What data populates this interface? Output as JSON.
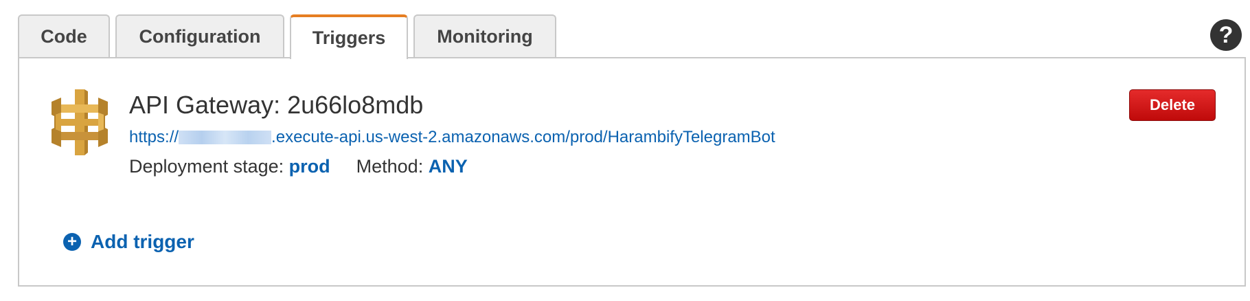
{
  "tabs": [
    {
      "label": "Code",
      "active": false
    },
    {
      "label": "Configuration",
      "active": false
    },
    {
      "label": "Triggers",
      "active": true
    },
    {
      "label": "Monitoring",
      "active": false
    }
  ],
  "help": {
    "icon": "help-icon",
    "glyph": "?"
  },
  "trigger": {
    "icon": "api-gateway-icon",
    "title": "API Gateway: 2u66lo8mdb",
    "url_prefix": "https://",
    "url_suffix": ".execute-api.us-west-2.amazonaws.com/prod/HarambifyTelegramBot",
    "deployment_stage_label": "Deployment stage:",
    "deployment_stage_value": "prod",
    "method_label": "Method:",
    "method_value": "ANY",
    "delete_label": "Delete"
  },
  "add_trigger": {
    "icon": "plus-circle-icon",
    "glyph": "+",
    "label": "Add trigger"
  },
  "colors": {
    "active_tab_accent": "#e67e22",
    "link": "#0b62b0",
    "delete_button": "#d61a1a",
    "api_gateway_logo": "#d9a440"
  }
}
